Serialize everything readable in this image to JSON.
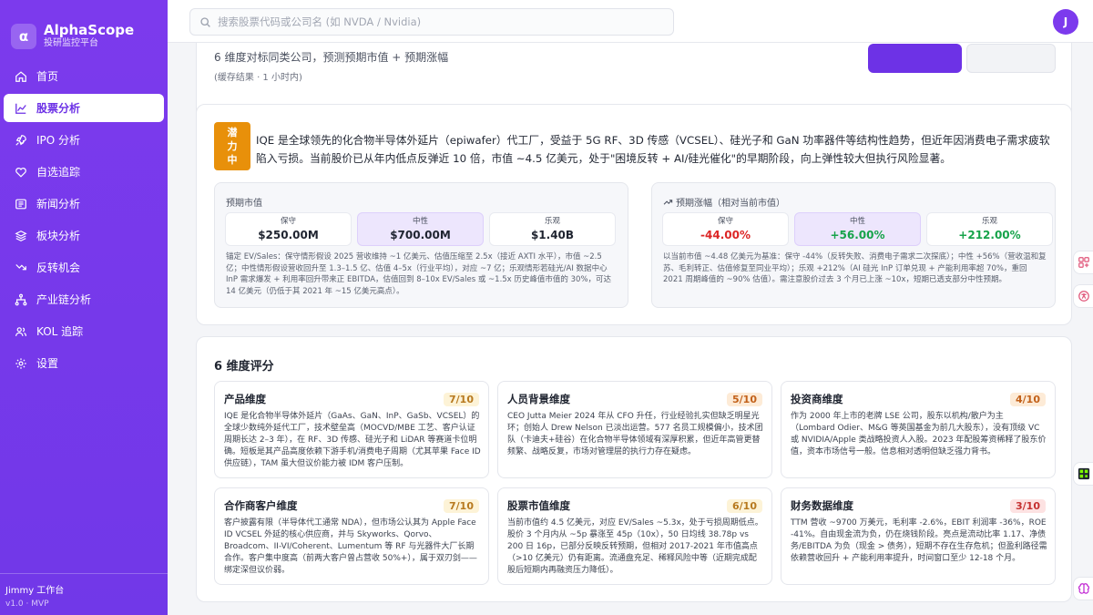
{
  "app": {
    "name": "AlphaScope",
    "subtitle": "投研监控平台",
    "logo_letter": "α"
  },
  "sidebar": {
    "items": [
      {
        "label": "首页",
        "icon": "home-icon"
      },
      {
        "label": "股票分析",
        "icon": "chart-line-icon",
        "active": true
      },
      {
        "label": "IPO 分析",
        "icon": "rocket-icon"
      },
      {
        "label": "自选追踪",
        "icon": "heart-icon"
      },
      {
        "label": "新闻分析",
        "icon": "newspaper-icon"
      },
      {
        "label": "板块分析",
        "icon": "layers-icon"
      },
      {
        "label": "反转机会",
        "icon": "reversal-icon"
      },
      {
        "label": "产业链分析",
        "icon": "network-icon"
      },
      {
        "label": "KOL 追踪",
        "icon": "users-icon"
      },
      {
        "label": "设置",
        "icon": "gear-icon"
      }
    ],
    "footer": {
      "user": "Jimmy 工作台",
      "version": "v1.0 · MVP"
    }
  },
  "topbar": {
    "search_placeholder": "搜索股票代码或公司名 (如 NVDA / Nvidia)",
    "avatar_letter": "J"
  },
  "header_card": {
    "subtitle": "6 维度对标同类公司，预测预期市值 + 预期涨幅",
    "cache_note": "(缓存结果 · 1 小时内)"
  },
  "summary_card": {
    "badge_chars": [
      "潜",
      "力",
      "中"
    ],
    "text": "IQE 是全球领先的化合物半导体外延片（epiwafer）代工厂，受益于 5G RF、3D 传感（VCSEL）、硅光子和 GaN 功率器件等结构性趋势，但近年因消费电子需求疲软陷入亏损。当前股价已从年内低点反弹近 10 倍，市值 ~4.5 亿美元，处于\"困境反转 + AI/硅光催化\"的早期阶段，向上弹性较大但执行风险显著。",
    "expected_cap": {
      "title": "预期市值",
      "tiles": [
        {
          "label": "保守",
          "value": "$250.00M"
        },
        {
          "label": "中性",
          "value": "$700.00M"
        },
        {
          "label": "乐观",
          "value": "$1.40B"
        }
      ],
      "note": "锚定 EV/Sales：保守情形假设 2025 营收维持 ~1 亿美元、估值压缩至 2.5x（接近 AXTI 水平），市值 ~2.5 亿；中性情形假设营收回升至 1.3–1.5 亿、估值 4–5x（行业平均），对应 ~7 亿；乐观情形若硅光/AI 数据中心 InP 需求爆发 + 利用率回升带来正 EBITDA，估值回到 8–10x EV/Sales 或 ~1.5x 历史峰值市值的 30%，可达 14 亿美元（仍低于其 2021 年 ~15 亿美元高点）。"
    },
    "expected_gain": {
      "title": "预期涨幅（相对当前市值）",
      "tiles": [
        {
          "label": "保守",
          "value": "-44.00%"
        },
        {
          "label": "中性",
          "value": "+56.00%"
        },
        {
          "label": "乐观",
          "value": "+212.00%"
        }
      ],
      "note": "以当前市值 ~4.48 亿美元为基准：保守 -44%（反转失败、消费电子需求二次探底）；中性 +56%（营收温和复苏、毛利转正、估值修复至同业平均）；乐观 +212%（AI 硅光 InP 订单兑现 + 产能利用率超 70%，重回 2021 周期峰值的 ~90% 估值）。需注意股价过去 3 个月已上涨 ~10x，短期已透支部分中性预期。"
    }
  },
  "dimensions": {
    "title": "6 维度评分",
    "items": [
      {
        "title": "产品维度",
        "score": "7/10",
        "level": "high",
        "text": "IQE 是化合物半导体外延片（GaAs、GaN、InP、GaSb、VCSEL）的全球少数纯外延代工厂，技术壁垒高（MOCVD/MBE 工艺、客户认证周期长达 2–3 年），在 RF、3D 传感、硅光子和 LiDAR 等赛道卡位明确。短板是其产品高度依赖下游手机/消费电子周期（尤其苹果 Face ID 供应链），TAM 虽大但议价能力被 IDM 客户压制。"
      },
      {
        "title": "人员背景维度",
        "score": "5/10",
        "level": "mid",
        "text": "CEO Jutta Meier 2024 年从 CFO 升任，行业经验扎实但缺乏明星光环；创始人 Drew Nelson 已淡出运营。577 名员工规模偏小，技术团队（卡迪夫+硅谷）在化合物半导体领域有深厚积累，但近年高管更替频繁、战略反复，市场对管理层的执行力存在疑虑。"
      },
      {
        "title": "投资商维度",
        "score": "4/10",
        "level": "mid",
        "text": "作为 2000 年上市的老牌 LSE 公司，股东以机构/散户为主（Lombard Odier、M&G 等英国基金为前几大股东），没有顶级 VC 或 NVIDIA/Apple 类战略投资人入股。2023 年配股筹资稀释了股东价值，资本市场信号一般。信息相对透明但缺乏强力背书。"
      },
      {
        "title": "合作商客户维度",
        "score": "7/10",
        "level": "high",
        "text": "客户披露有限（半导体代工通常 NDA），但市场公认其为 Apple Face ID VCSEL 外延的核心供应商，并与 Skyworks、Qorvo、Broadcom、II-VI/Coherent、Lumentum 等 RF 与光器件大厂长期合作。客户集中度高（前两大客户曾占营收 50%+），属于双刃剑——绑定深但议价弱。"
      },
      {
        "title": "股票市值维度",
        "score": "6/10",
        "level": "high",
        "text": "当前市值约 4.5 亿美元，对应 EV/Sales ~5.3x，处于亏损周期低点。股价 3 个月内从 ~5p 暴涨至 45p（10x），50 日均线 38.78p vs 200 日 16p，已部分反映反转预期，但相对 2017-2021 年市值高点（>10 亿美元）仍有距离。流通盘充足、稀释风险中等（近期完成配股后短期内再融资压力降低）。"
      },
      {
        "title": "财务数据维度",
        "score": "3/10",
        "level": "low",
        "text": "TTM 营收 ~9700 万美元，毛利率 -2.6%，EBIT 利润率 -36%，ROE -41%。自由现金流为负，仍在烧钱阶段。亮点是流动比率 1.17、净债务/EBITDA 为负（现金 > 债务），短期不存在生存危机；但盈利路径需依赖营收回升 + 产能利用率提升，时间窗口至少 12-18 个月。"
      }
    ]
  },
  "colors": {
    "primary": "#7c3aed",
    "badge_orange": "#e8900a",
    "negative": "#dc2626",
    "positive": "#16a34a",
    "score_high_bg": "#fdf3d7",
    "score_high_fg": "#b7791f",
    "score_mid_bg": "#fdebd7",
    "score_mid_fg": "#c2611a",
    "score_low_bg": "#fde2e2",
    "score_low_fg": "#c53030"
  }
}
